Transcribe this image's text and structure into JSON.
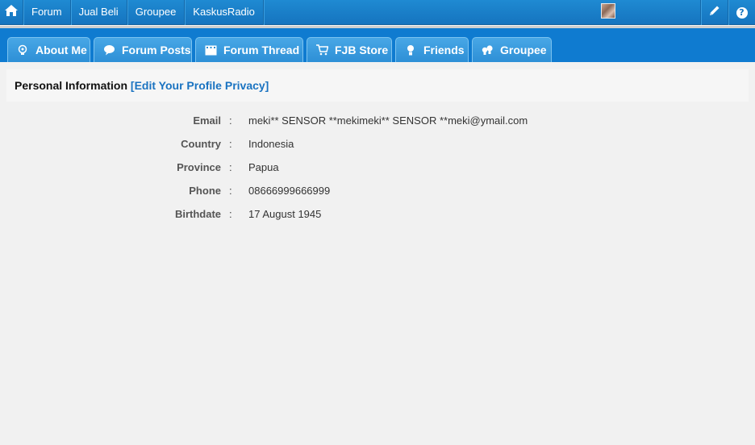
{
  "topnav": {
    "items": [
      {
        "label": "Forum"
      },
      {
        "label": "Jual Beli"
      },
      {
        "label": "Groupee"
      },
      {
        "label": "KaskusRadio"
      }
    ]
  },
  "tabs": [
    {
      "label": "About Me",
      "icon": "bulb-person-icon"
    },
    {
      "label": "Forum Posts",
      "icon": "speech-bubble-icon"
    },
    {
      "label": "Forum Thread",
      "icon": "film-strip-icon"
    },
    {
      "label": "FJB Store",
      "icon": "shopping-cart-icon"
    },
    {
      "label": "Friends",
      "icon": "person-icon"
    },
    {
      "label": "Groupee",
      "icon": "people-icon"
    }
  ],
  "section": {
    "title": "Personal Information",
    "edit_link": "[Edit Your Profile Privacy]"
  },
  "info": {
    "separator": ":",
    "rows": [
      {
        "label": "Email",
        "value": "meki** SENSOR **mekimeki** SENSOR **meki@ymail.com"
      },
      {
        "label": "Country",
        "value": "Indonesia"
      },
      {
        "label": "Province",
        "value": "Papua"
      },
      {
        "label": "Phone",
        "value": "08666999666999"
      },
      {
        "label": "Birthdate",
        "value": "17 August 1945"
      }
    ]
  },
  "colors": {
    "topbar": "#1574bf",
    "tabbar": "#0f7bd0",
    "tab": "#2d8fd6",
    "link": "#1a73c1",
    "background": "#f1f1f1"
  }
}
